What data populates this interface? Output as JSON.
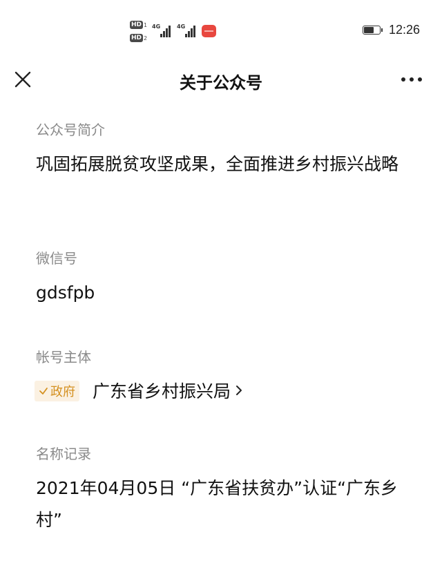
{
  "status_bar": {
    "hd1": "HD",
    "hd1_sub": "1",
    "hd2": "HD",
    "hd2_sub": "2",
    "network1": "4G",
    "network2": "4G",
    "battery_level": 0.7,
    "time": "12:26"
  },
  "nav": {
    "close_icon": "close-icon",
    "title": "关于公众号",
    "more_icon": "more-icon"
  },
  "sections": {
    "intro": {
      "label": "公众号简介",
      "value": "巩固拓展脱贫攻坚成果，全面推进乡村振兴战略"
    },
    "wechat_id": {
      "label": "微信号",
      "value": "gdsfpb"
    },
    "entity": {
      "label": "帐号主体",
      "badge": "政府",
      "badge_color": "#d4901f",
      "value": "广东省乡村振兴局"
    },
    "name_history": {
      "label": "名称记录",
      "value": "2021年04月05日 “广东省扶贫办”认证“广东乡村”"
    }
  }
}
